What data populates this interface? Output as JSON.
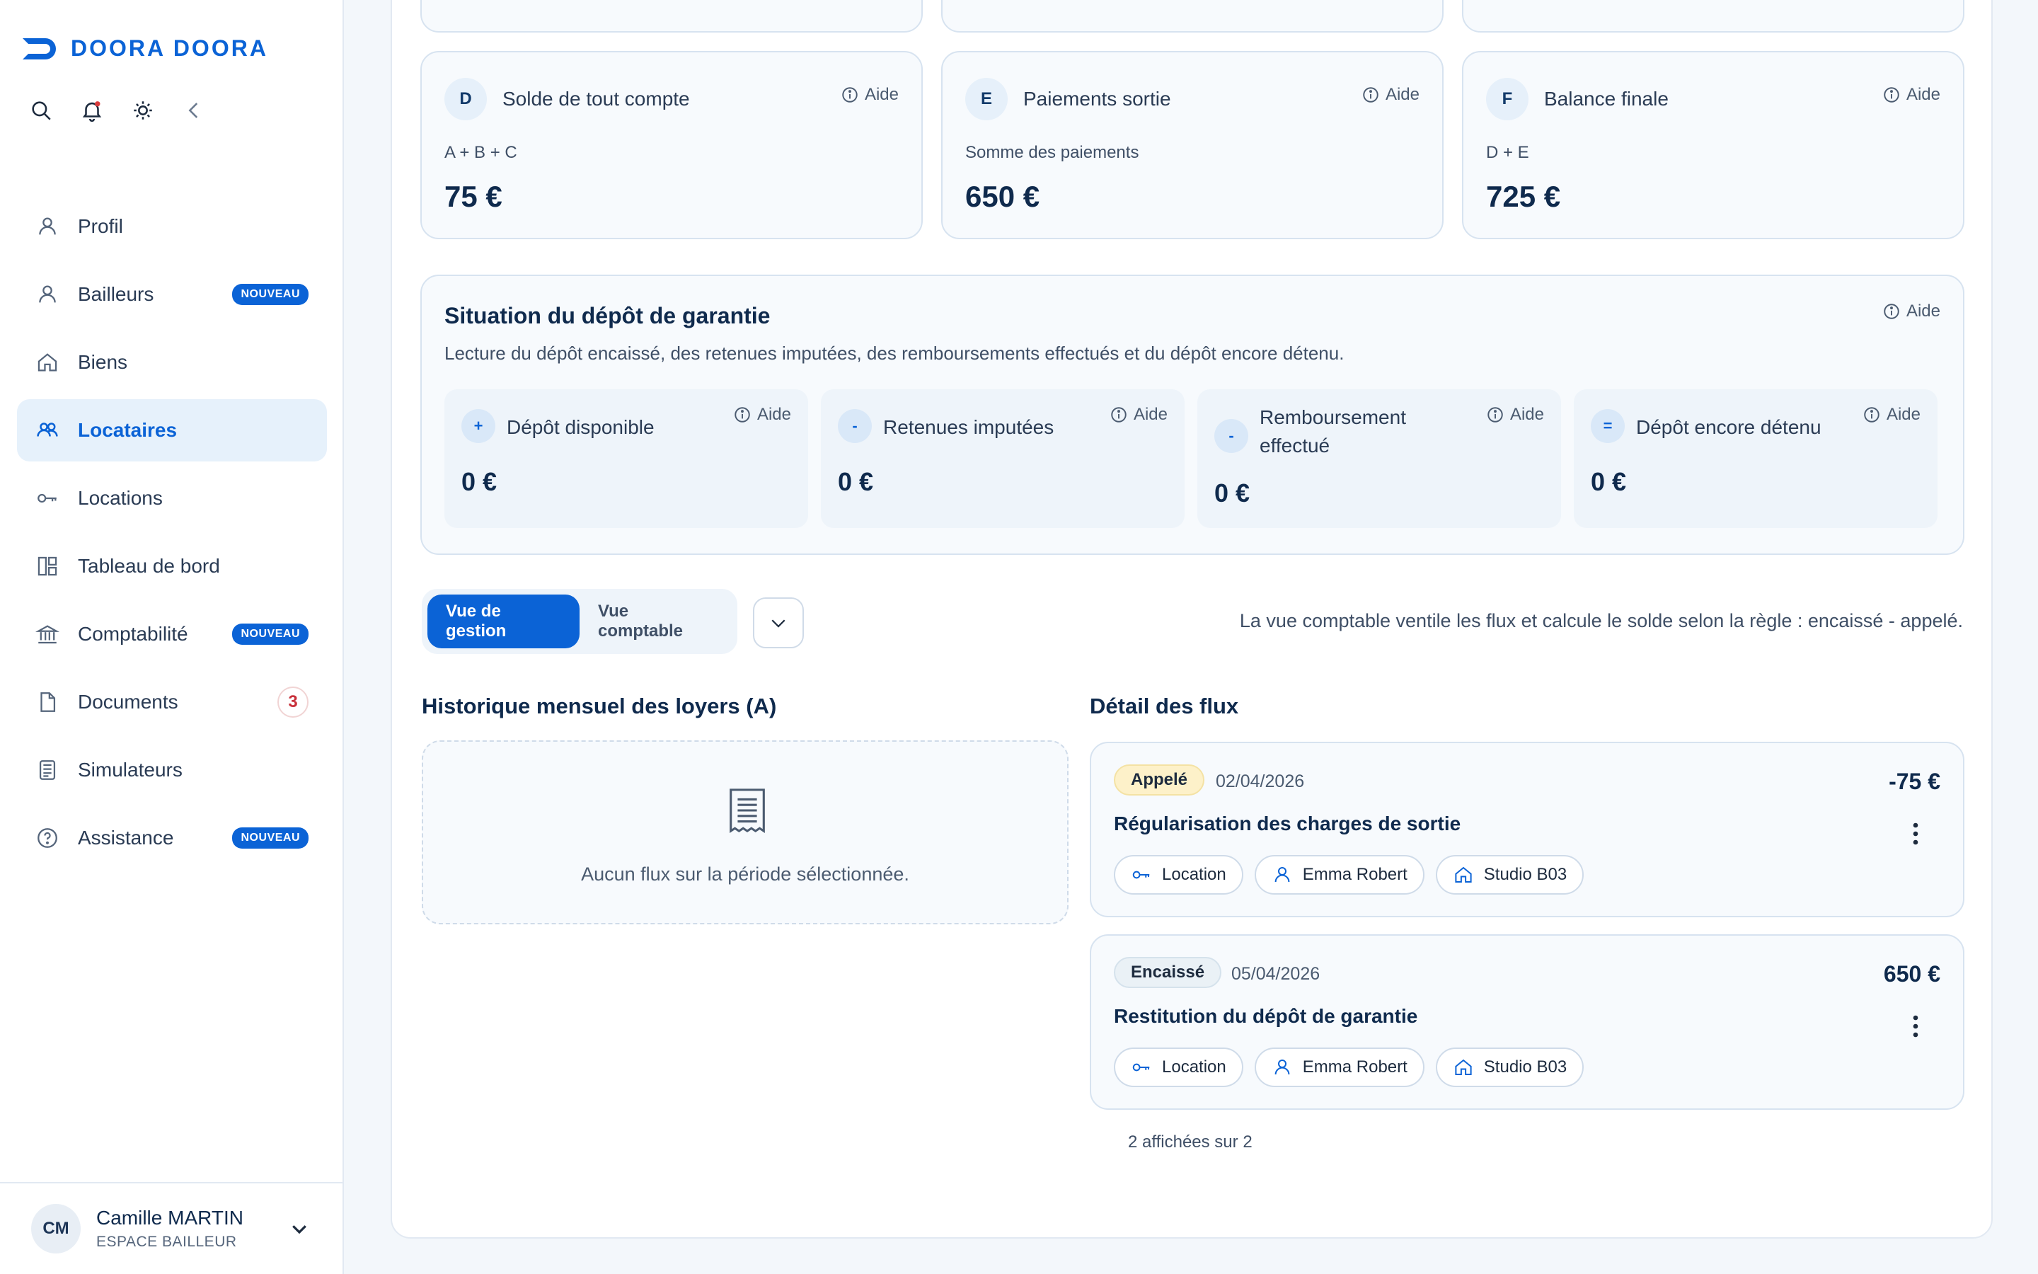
{
  "app": {
    "logo_text": "DOORA DOORA",
    "accent": "#0b63d6"
  },
  "sidebar": {
    "tools": [
      "search-icon",
      "bell-icon",
      "sun-icon",
      "chevron-left-icon"
    ],
    "items": [
      {
        "label": "Profil",
        "icon": "user-icon"
      },
      {
        "label": "Bailleurs",
        "icon": "user-icon",
        "badge": "NOUVEAU"
      },
      {
        "label": "Biens",
        "icon": "house-icon"
      },
      {
        "label": "Locataires",
        "icon": "users-icon",
        "active": true
      },
      {
        "label": "Locations",
        "icon": "key-icon"
      },
      {
        "label": "Tableau de bord",
        "icon": "dashboard-icon"
      },
      {
        "label": "Comptabilité",
        "icon": "bank-icon",
        "badge": "NOUVEAU"
      },
      {
        "label": "Documents",
        "icon": "document-icon",
        "count": "3"
      },
      {
        "label": "Simulateurs",
        "icon": "calculator-icon"
      },
      {
        "label": "Assistance",
        "icon": "help-circle-icon",
        "badge": "NOUVEAU"
      }
    ],
    "user": {
      "initials": "CM",
      "name": "Camille MARTIN",
      "role": "ESPACE BAILLEUR"
    }
  },
  "help_label": "Aide",
  "kpis": [
    {
      "letter": "D",
      "title": "Solde de tout compte",
      "formula": "A + B + C",
      "value": "75 €"
    },
    {
      "letter": "E",
      "title": "Paiements sortie",
      "formula": "Somme des paiements",
      "value": "650 €"
    },
    {
      "letter": "F",
      "title": "Balance finale",
      "formula": "D + E",
      "value": "725 €"
    }
  ],
  "deposit": {
    "title": "Situation du dépôt de garantie",
    "description": "Lecture du dépôt encaissé, des retenues imputées, des remboursements effectués et du dépôt encore détenu.",
    "items": [
      {
        "sign": "+",
        "title": "Dépôt disponible",
        "value": "0 €"
      },
      {
        "sign": "-",
        "title": "Retenues imputées",
        "value": "0 €"
      },
      {
        "sign": "-",
        "title": "Remboursement effectué",
        "value": "0 €"
      },
      {
        "sign": "=",
        "title": "Dépôt encore détenu",
        "value": "0 €"
      }
    ]
  },
  "views": {
    "management": "Vue de gestion",
    "accounting": "Vue comptable",
    "rule": "La vue comptable ventile les flux et calcule le solde selon la règle : encaissé - appelé."
  },
  "history": {
    "title": "Historique mensuel des loyers (A)",
    "empty": "Aucun flux sur la période sélectionnée."
  },
  "flux": {
    "title": "Détail des flux",
    "items": [
      {
        "status": "Appelé",
        "date": "02/04/2026",
        "amount": "-75 €",
        "label": "Régularisation des charges de sortie",
        "chips": [
          "Location",
          "Emma Robert",
          "Studio B03"
        ]
      },
      {
        "status": "Encaissé",
        "date": "05/04/2026",
        "amount": "650 €",
        "label": "Restitution du dépôt de garantie",
        "chips": [
          "Location",
          "Emma Robert",
          "Studio B03"
        ]
      }
    ],
    "count": "2 affichées sur 2"
  }
}
